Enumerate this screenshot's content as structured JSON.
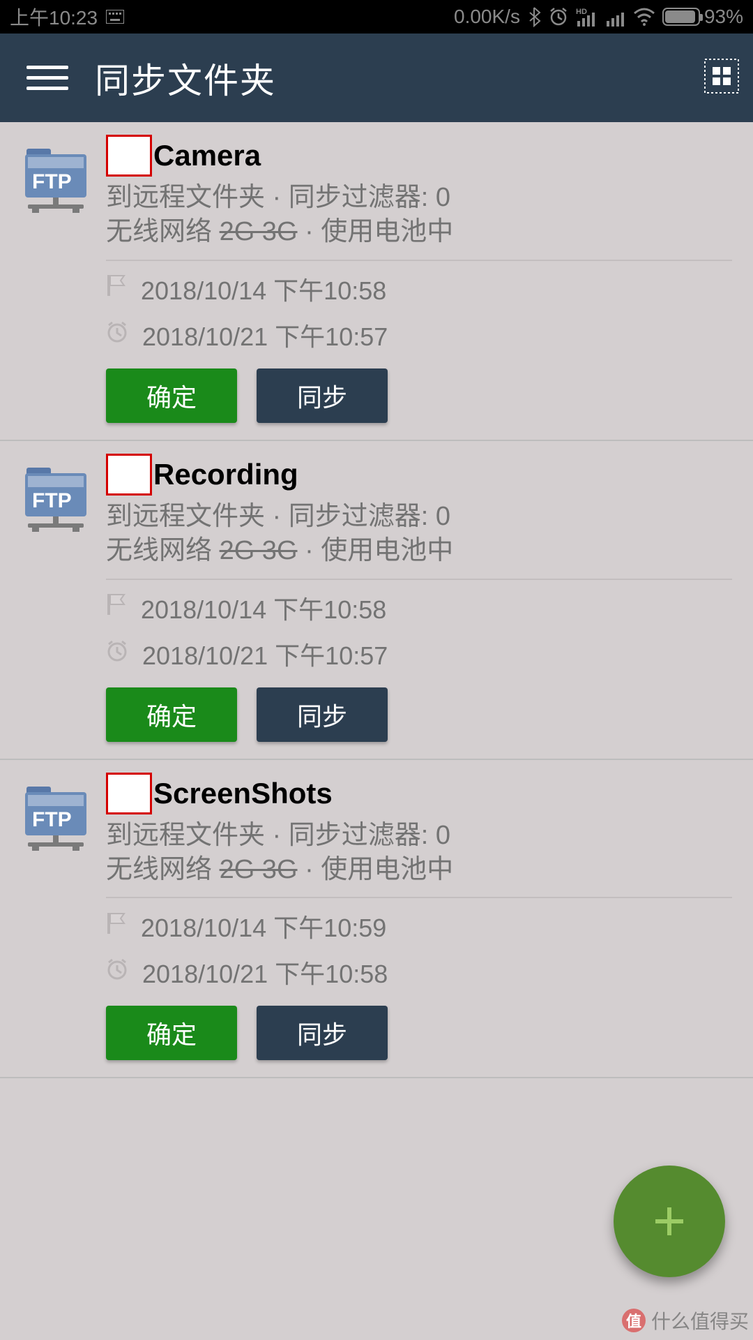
{
  "status": {
    "time": "上午10:23",
    "speed": "0.00K/s",
    "battery_pct_text": "93%",
    "battery_fill_pct": 93
  },
  "appbar": {
    "title": "同步文件夹"
  },
  "buttons": {
    "ok": "确定",
    "sync": "同步"
  },
  "desc_parts": {
    "line1_a": "到远程文件夹 · 同步过滤器: 0",
    "line2_a": "无线网络 ",
    "line2_strike": "2G 3G",
    "line2_b": " · 使用电池中"
  },
  "items": [
    {
      "title": "Camera",
      "flag_time": "2018/10/14 下午10:58",
      "alarm_time": "2018/10/21 下午10:57"
    },
    {
      "title": "Recording",
      "flag_time": "2018/10/14 下午10:58",
      "alarm_time": "2018/10/21 下午10:57"
    },
    {
      "title": "ScreenShots",
      "flag_time": "2018/10/14 下午10:59",
      "alarm_time": "2018/10/21 下午10:58"
    }
  ],
  "watermark": {
    "badge": "值",
    "text": "什么值得买"
  }
}
